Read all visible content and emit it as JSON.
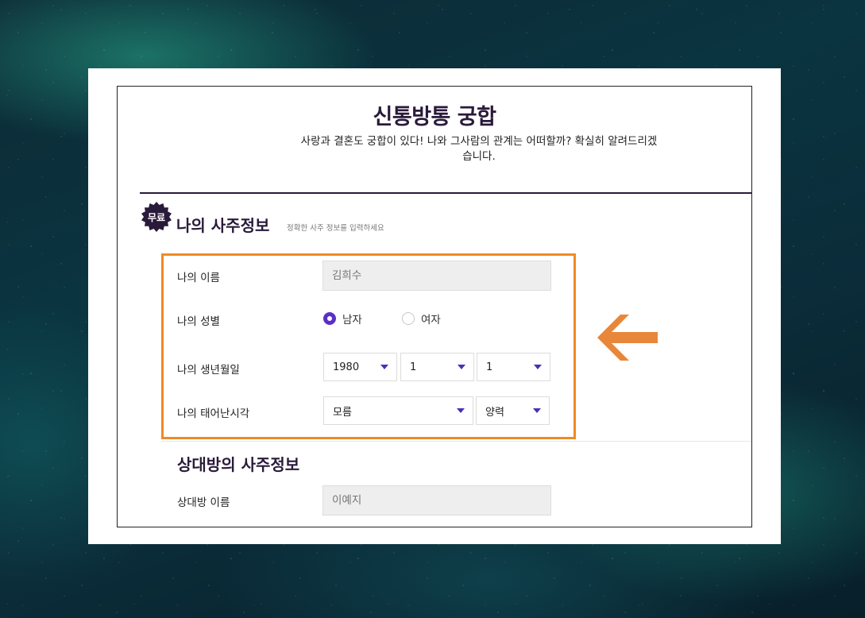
{
  "page": {
    "title": "신통방통 궁합",
    "subtitle": "사랑과 결혼도 궁합이 있다! 나와 그사람의 관계는 어떠할까? 확실히 알려드리겠습니다."
  },
  "my_section": {
    "badge": "무료",
    "title": "나의 사주정보",
    "hint": "정확한 사주 정보를 입력하세요",
    "name_label": "나의 이름",
    "name_placeholder": "김희수",
    "gender_label": "나의 성별",
    "gender_options": [
      "남자",
      "여자"
    ],
    "gender_selected": "남자",
    "birth_label": "나의 생년월일",
    "birth_year": "1980",
    "birth_month": "1",
    "birth_day": "1",
    "time_label": "나의 태어난시각",
    "birth_time": "모름",
    "calendar": "양력"
  },
  "partner_section": {
    "title": "상대방의 사주정보",
    "name_label": "상대방 이름",
    "name_placeholder": "이예지"
  },
  "colors": {
    "accent": "#5b2fc7",
    "highlight_border": "#f08a24",
    "arrow": "#e8873a",
    "title": "#2a1a3a"
  },
  "icons": [
    "badge-starburst-icon",
    "dropdown-caret-icon",
    "left-arrow-icon"
  ]
}
